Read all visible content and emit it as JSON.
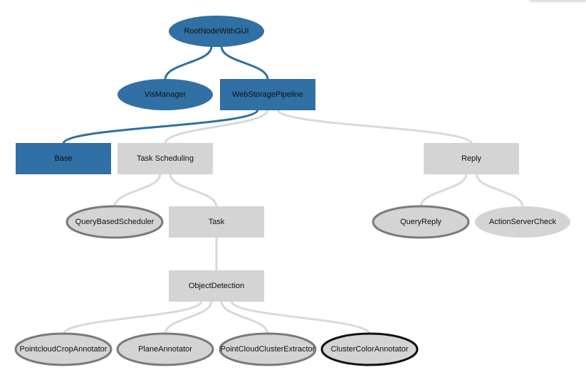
{
  "colors": {
    "active_fill": "#3070a4",
    "inactive_fill": "#d4d4d4",
    "active_edge": "#2f6fa3",
    "inactive_edge": "#d9d9d9",
    "outline_gray": "#7a7a7a",
    "outline_black": "#111111",
    "text": "#111111"
  },
  "nodes": [
    {
      "id": "root",
      "label": "RootNodeWithGUI",
      "shape": "ellipse",
      "state": "active",
      "outline": "none",
      "level": 0
    },
    {
      "id": "vis",
      "label": "VisManager",
      "shape": "ellipse",
      "state": "active",
      "outline": "none",
      "level": 1
    },
    {
      "id": "web",
      "label": "WebStoragePipeline",
      "shape": "box",
      "state": "active",
      "outline": "none",
      "level": 1
    },
    {
      "id": "base",
      "label": "Base",
      "shape": "box",
      "state": "active",
      "outline": "none",
      "level": 2
    },
    {
      "id": "tasksched",
      "label": "Task Scheduling",
      "shape": "box",
      "state": "inactive",
      "outline": "none",
      "level": 2
    },
    {
      "id": "reply",
      "label": "Reply",
      "shape": "box",
      "state": "inactive",
      "outline": "none",
      "level": 2
    },
    {
      "id": "qbs",
      "label": "QueryBasedScheduler",
      "shape": "ellipse",
      "state": "inactive",
      "outline": "gray",
      "level": 3
    },
    {
      "id": "task",
      "label": "Task",
      "shape": "box",
      "state": "inactive",
      "outline": "none",
      "level": 3
    },
    {
      "id": "qreply",
      "label": "QueryReply",
      "shape": "ellipse",
      "state": "inactive",
      "outline": "gray",
      "level": 3
    },
    {
      "id": "asc",
      "label": "ActionServerCheck",
      "shape": "ellipse",
      "state": "inactive",
      "outline": "none",
      "level": 3
    },
    {
      "id": "objdet",
      "label": "ObjectDetection",
      "shape": "box",
      "state": "inactive",
      "outline": "none",
      "level": 4
    },
    {
      "id": "pcrop",
      "label": "PointcloudCropAnnotator",
      "shape": "ellipse",
      "state": "inactive",
      "outline": "gray",
      "level": 5
    },
    {
      "id": "plane",
      "label": "PlaneAnnotator",
      "shape": "ellipse",
      "state": "inactive",
      "outline": "gray",
      "level": 5
    },
    {
      "id": "pcce",
      "label": "PointCloudClusterExtractor",
      "shape": "ellipse",
      "state": "inactive",
      "outline": "gray",
      "level": 5
    },
    {
      "id": "cca",
      "label": "ClusterColorAnnotator",
      "shape": "ellipse",
      "state": "inactive",
      "outline": "black",
      "level": 5
    }
  ],
  "edges": [
    {
      "from": "root",
      "to": "vis",
      "state": "active"
    },
    {
      "from": "root",
      "to": "web",
      "state": "active"
    },
    {
      "from": "web",
      "to": "base",
      "state": "active"
    },
    {
      "from": "web",
      "to": "tasksched",
      "state": "inactive"
    },
    {
      "from": "web",
      "to": "reply",
      "state": "inactive"
    },
    {
      "from": "tasksched",
      "to": "qbs",
      "state": "inactive"
    },
    {
      "from": "tasksched",
      "to": "task",
      "state": "inactive"
    },
    {
      "from": "reply",
      "to": "qreply",
      "state": "inactive"
    },
    {
      "from": "reply",
      "to": "asc",
      "state": "inactive"
    },
    {
      "from": "task",
      "to": "objdet",
      "state": "inactive"
    },
    {
      "from": "objdet",
      "to": "pcrop",
      "state": "inactive"
    },
    {
      "from": "objdet",
      "to": "plane",
      "state": "inactive"
    },
    {
      "from": "objdet",
      "to": "pcce",
      "state": "inactive"
    },
    {
      "from": "objdet",
      "to": "cca",
      "state": "inactive"
    }
  ]
}
